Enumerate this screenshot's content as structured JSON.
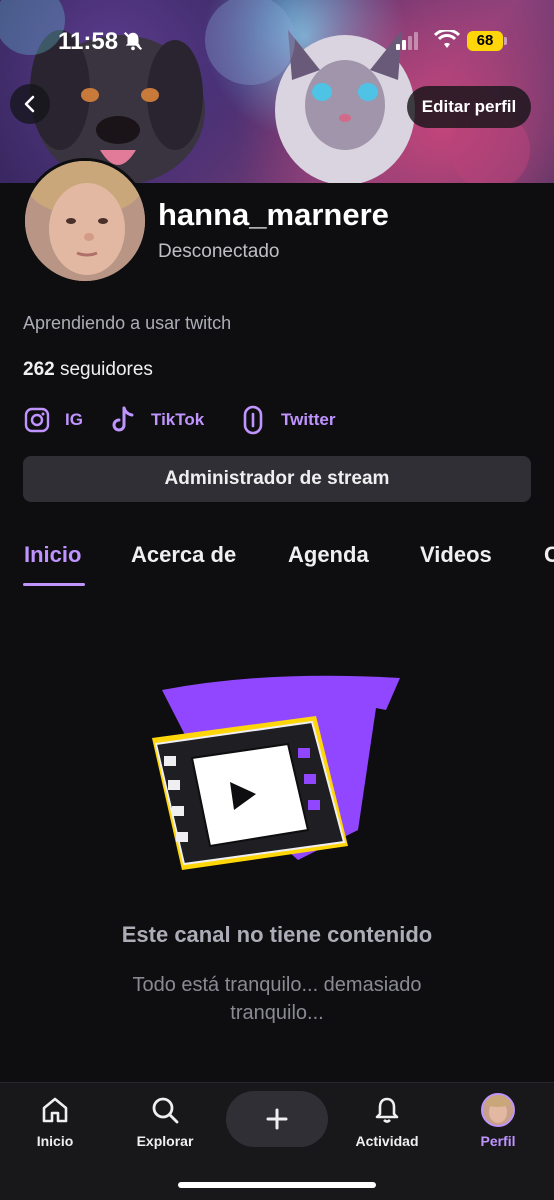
{
  "status_bar": {
    "time": "11:58",
    "battery": "68",
    "icons": [
      "bell-slash-icon",
      "signal-icon",
      "wifi-icon",
      "battery-icon"
    ],
    "battery_color": "#ffd60a"
  },
  "header": {
    "back_icon": "chevron-left-icon",
    "edit_label": "Editar perfil"
  },
  "profile": {
    "username": "hanna_marnere",
    "status": "Desconectado",
    "bio": "Aprendiendo a usar twitch",
    "followers_count": "262",
    "followers_label": " seguidores"
  },
  "socials": [
    {
      "label": "IG",
      "icon": "instagram-icon"
    },
    {
      "label": "TikTok",
      "icon": "tiktok-icon"
    },
    {
      "label": "Twitter",
      "icon": "link-icon"
    }
  ],
  "stream_manager_label": "Administrador de stream",
  "tabs": [
    {
      "label": "Inicio",
      "active": true
    },
    {
      "label": "Acerca de",
      "active": false
    },
    {
      "label": "Agenda",
      "active": false
    },
    {
      "label": "Videos",
      "active": false
    },
    {
      "label": "C",
      "active": false
    }
  ],
  "empty_state": {
    "title": "Este canal no tiene contenido",
    "subtitle": "Todo está tranquilo... demasiado tranquilo..."
  },
  "bottom_nav": [
    {
      "label": "Inicio",
      "icon": "home-icon",
      "active": false
    },
    {
      "label": "Explorar",
      "icon": "search-icon",
      "active": false
    },
    {
      "label": "",
      "icon": "plus-icon",
      "active": false
    },
    {
      "label": "Actividad",
      "icon": "bell-icon",
      "active": false
    },
    {
      "label": "Perfil",
      "icon": "avatar-icon",
      "active": true
    }
  ],
  "colors": {
    "accent": "#bf94ff",
    "background": "#0e0e10",
    "button_bg": "#2f2f35",
    "nav_bg": "#18181b"
  }
}
